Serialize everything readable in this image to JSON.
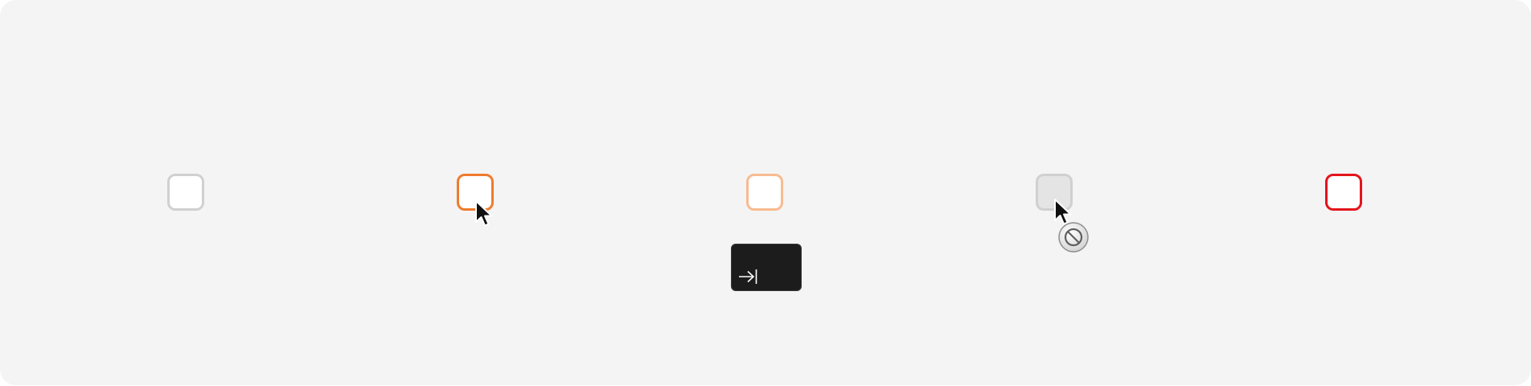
{
  "checkboxes": [
    {
      "state": "default",
      "checked": false,
      "border_color": "#d0d0d0",
      "fill_color": "#ffffff"
    },
    {
      "state": "hover",
      "checked": false,
      "border_color": "#ef7b2d",
      "fill_color": "#ffffff"
    },
    {
      "state": "focus",
      "checked": false,
      "border_color": "#f8bb90",
      "fill_color": "#ffffff"
    },
    {
      "state": "disabled",
      "checked": false,
      "border_color": "#d0d0d0",
      "fill_color": "#e4e4e4"
    },
    {
      "state": "error",
      "checked": false,
      "border_color": "#e3141c",
      "fill_color": "#ffffff"
    }
  ],
  "indicators": {
    "hover_cursor": "arrow-pointer-icon",
    "disabled_cursor": "arrow-pointer-icon",
    "disabled_badge": "not-allowed-icon",
    "focus_key": "tab-key-icon"
  },
  "colors": {
    "background": "#f4f4f4",
    "key_background": "#1c1c1c"
  }
}
